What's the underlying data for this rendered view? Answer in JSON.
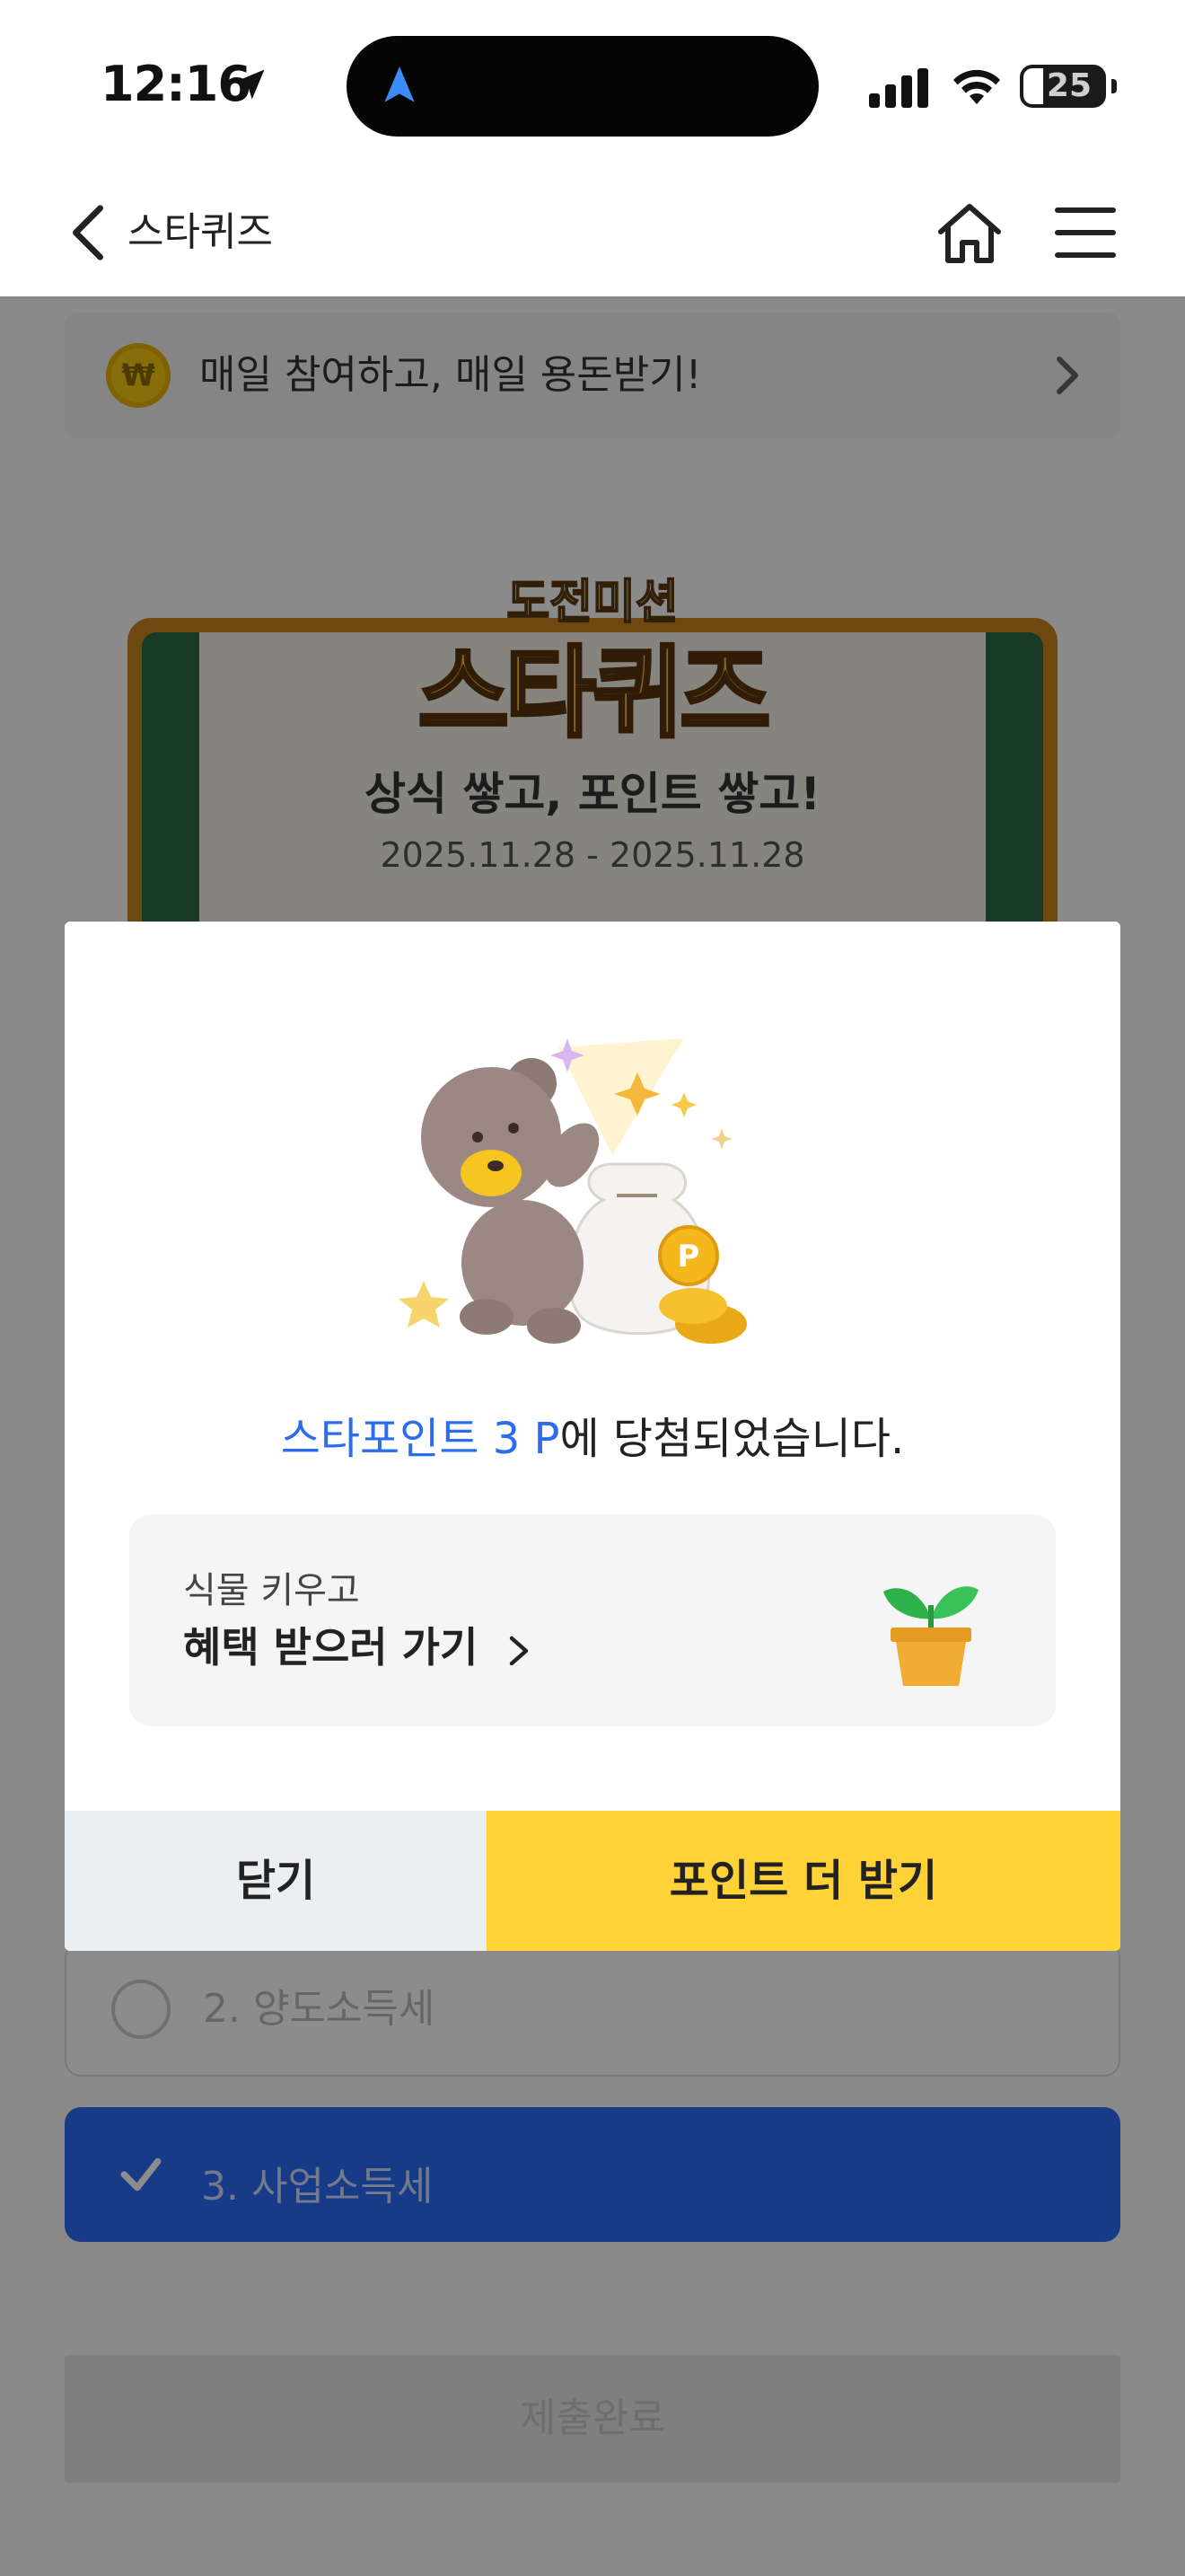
{
  "status_bar": {
    "time": "12:16",
    "battery": "25"
  },
  "navbar": {
    "title": "스타퀴즈"
  },
  "promo": {
    "coin_symbol": "₩",
    "text": "매일 참여하고, 매일 용돈받기!"
  },
  "quiz": {
    "logo_sub": "도전미션",
    "logo": "스타퀴즈",
    "heading": "상식 쌓고, 포인트 쌓고!",
    "date_range": "2025.11.28 - 2025.11.28",
    "options": [
      {
        "label": "2. 양도소득세",
        "selected": false
      },
      {
        "label": "3. 사업소득세",
        "selected": true
      }
    ],
    "submit_label": "제출완료"
  },
  "modal": {
    "win_highlight": "스타포인트 3 P",
    "win_rest": "에 당첨되었습니다.",
    "benefit_sub": "식물 키우고",
    "benefit_main": "혜택 받으러 가기",
    "close_label": "닫기",
    "more_label": "포인트 더 받기"
  },
  "colors": {
    "accent_blue": "#2c6cf0",
    "button_yellow": "#ffd338",
    "selected_option": "#2a6cf6"
  },
  "icons": [
    "location-arrow-icon",
    "navigation-icon",
    "signal-icon",
    "wifi-icon",
    "battery-icon",
    "back-chevron-icon",
    "home-icon",
    "menu-icon",
    "coin-icon",
    "chevron-right-icon",
    "checkmark-icon",
    "bear-illustration",
    "plant-pot-icon"
  ]
}
